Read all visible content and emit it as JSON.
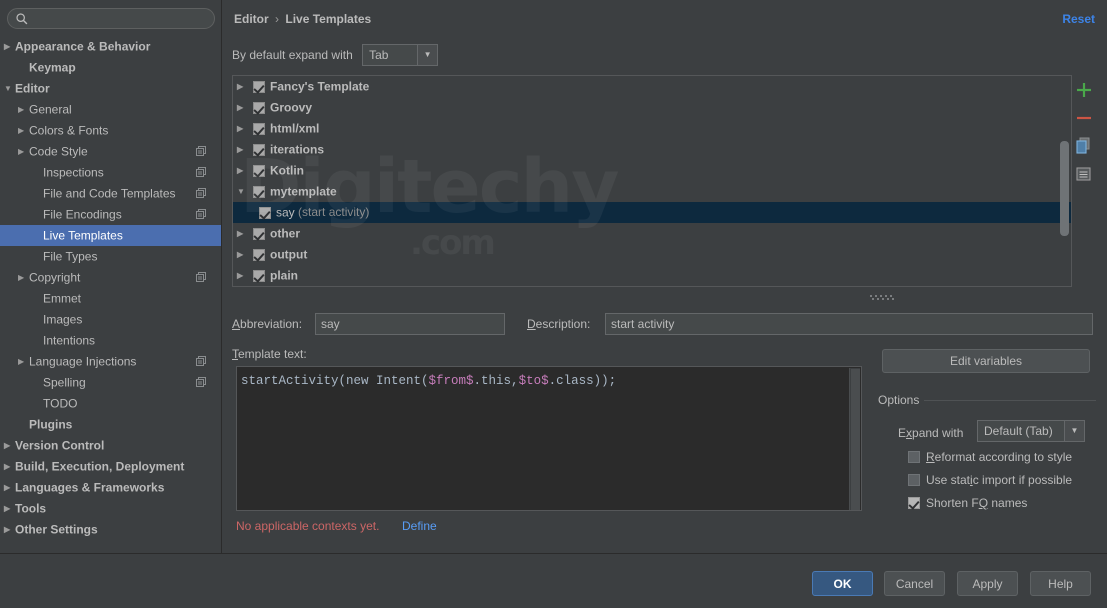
{
  "search": {
    "value": "",
    "placeholder": "",
    "icon": "search-icon"
  },
  "sidebar": {
    "items": [
      {
        "label": "Appearance & Behavior",
        "arrow": "▶",
        "bold": true,
        "indent": 0,
        "selected": false,
        "mod": false
      },
      {
        "label": "Keymap",
        "arrow": "",
        "bold": true,
        "indent": 1,
        "selected": false,
        "mod": false
      },
      {
        "label": "Editor",
        "arrow": "▼",
        "bold": true,
        "indent": 0,
        "selected": false,
        "mod": false
      },
      {
        "label": "General",
        "arrow": "▶",
        "bold": false,
        "indent": 1,
        "selected": false,
        "mod": false
      },
      {
        "label": "Colors & Fonts",
        "arrow": "▶",
        "bold": false,
        "indent": 1,
        "selected": false,
        "mod": false
      },
      {
        "label": "Code Style",
        "arrow": "▶",
        "bold": false,
        "indent": 1,
        "selected": false,
        "mod": true
      },
      {
        "label": "Inspections",
        "arrow": "",
        "bold": false,
        "indent": 2,
        "selected": false,
        "mod": true
      },
      {
        "label": "File and Code Templates",
        "arrow": "",
        "bold": false,
        "indent": 2,
        "selected": false,
        "mod": true
      },
      {
        "label": "File Encodings",
        "arrow": "",
        "bold": false,
        "indent": 2,
        "selected": false,
        "mod": true
      },
      {
        "label": "Live Templates",
        "arrow": "",
        "bold": false,
        "indent": 2,
        "selected": true,
        "mod": false
      },
      {
        "label": "File Types",
        "arrow": "",
        "bold": false,
        "indent": 2,
        "selected": false,
        "mod": false
      },
      {
        "label": "Copyright",
        "arrow": "▶",
        "bold": false,
        "indent": 1,
        "selected": false,
        "mod": true
      },
      {
        "label": "Emmet",
        "arrow": "",
        "bold": false,
        "indent": 2,
        "selected": false,
        "mod": false
      },
      {
        "label": "Images",
        "arrow": "",
        "bold": false,
        "indent": 2,
        "selected": false,
        "mod": false
      },
      {
        "label": "Intentions",
        "arrow": "",
        "bold": false,
        "indent": 2,
        "selected": false,
        "mod": false
      },
      {
        "label": "Language Injections",
        "arrow": "▶",
        "bold": false,
        "indent": 1,
        "selected": false,
        "mod": true
      },
      {
        "label": "Spelling",
        "arrow": "",
        "bold": false,
        "indent": 2,
        "selected": false,
        "mod": true
      },
      {
        "label": "TODO",
        "arrow": "",
        "bold": false,
        "indent": 2,
        "selected": false,
        "mod": false
      },
      {
        "label": "Plugins",
        "arrow": "",
        "bold": true,
        "indent": 1,
        "selected": false,
        "mod": false
      },
      {
        "label": "Version Control",
        "arrow": "▶",
        "bold": true,
        "indent": 0,
        "selected": false,
        "mod": false
      },
      {
        "label": "Build, Execution, Deployment",
        "arrow": "▶",
        "bold": true,
        "indent": 0,
        "selected": false,
        "mod": false
      },
      {
        "label": "Languages & Frameworks",
        "arrow": "▶",
        "bold": true,
        "indent": 0,
        "selected": false,
        "mod": false
      },
      {
        "label": "Tools",
        "arrow": "▶",
        "bold": true,
        "indent": 0,
        "selected": false,
        "mod": false
      },
      {
        "label": "Other Settings",
        "arrow": "▶",
        "bold": true,
        "indent": 0,
        "selected": false,
        "mod": false
      }
    ]
  },
  "header": {
    "breadcrumb_root": "Editor",
    "breadcrumb_sep": "›",
    "breadcrumb_leaf": "Live Templates",
    "reset_label": "Reset"
  },
  "expand_default": {
    "label": "By default expand with",
    "value": "Tab",
    "arrow": "▼"
  },
  "templates": {
    "rows": [
      {
        "label": "Fancy's Template",
        "desc": "",
        "arrow": "▶",
        "checked": true,
        "child": false,
        "selected": false
      },
      {
        "label": "Groovy",
        "desc": "",
        "arrow": "▶",
        "checked": true,
        "child": false,
        "selected": false
      },
      {
        "label": "html/xml",
        "desc": "",
        "arrow": "▶",
        "checked": true,
        "child": false,
        "selected": false
      },
      {
        "label": "iterations",
        "desc": "",
        "arrow": "▶",
        "checked": true,
        "child": false,
        "selected": false
      },
      {
        "label": "Kotlin",
        "desc": "",
        "arrow": "▶",
        "checked": true,
        "child": false,
        "selected": false
      },
      {
        "label": "mytemplate",
        "desc": "",
        "arrow": "▼",
        "checked": true,
        "child": false,
        "selected": false
      },
      {
        "label": "say",
        "desc": "(start activity)",
        "arrow": "",
        "checked": true,
        "child": true,
        "selected": true
      },
      {
        "label": "other",
        "desc": "",
        "arrow": "▶",
        "checked": true,
        "child": false,
        "selected": false
      },
      {
        "label": "output",
        "desc": "",
        "arrow": "▶",
        "checked": true,
        "child": false,
        "selected": false
      },
      {
        "label": "plain",
        "desc": "",
        "arrow": "▶",
        "checked": true,
        "child": false,
        "selected": false
      }
    ],
    "toolbar": [
      {
        "name": "add-template-button",
        "glyph": "+",
        "color": "#4aa84a"
      },
      {
        "name": "remove-template-button",
        "glyph": "−",
        "color": "#cc5544"
      },
      {
        "name": "duplicate-template-button",
        "glyph": "copy",
        "color": "#5f9fd0"
      },
      {
        "name": "template-group-button",
        "glyph": "list",
        "color": "#9a9a9a"
      }
    ]
  },
  "details": {
    "abbreviation_label": "Abbreviation:",
    "abbreviation_mnemonic": "A",
    "abbreviation_value": "say",
    "description_label": "Description:",
    "description_mnemonic": "D",
    "description_value": "start activity",
    "template_text_label": "Template text:",
    "template_text_mnemonic": "T",
    "code": {
      "prefix": "startActivity(new Intent(",
      "var1": "$from$",
      "middle": ".this,",
      "var2": "$to$",
      "suffix": ".class));"
    },
    "context_warning": "No applicable contexts yet.",
    "context_define_link": "Define"
  },
  "options": {
    "edit_variables_label": "Edit variables",
    "legend": "Options",
    "expand_with_label": "Expand with",
    "expand_with_mnemonic": "x",
    "expand_with_value": "Default (Tab)",
    "expand_with_arrow": "▼",
    "checkboxes": [
      {
        "label": "Reformat according to style",
        "mnemonic": "R",
        "checked": false
      },
      {
        "label": "Use static import if possible",
        "mnemonic": "i",
        "checked": false
      },
      {
        "label": "Shorten FQ names",
        "mnemonic": "Q",
        "checked": true
      }
    ]
  },
  "footer": {
    "ok": "OK",
    "cancel": "Cancel",
    "apply": "Apply",
    "help": "Help"
  },
  "watermark": {
    "main": "Digitechy",
    "sub": ".com"
  }
}
